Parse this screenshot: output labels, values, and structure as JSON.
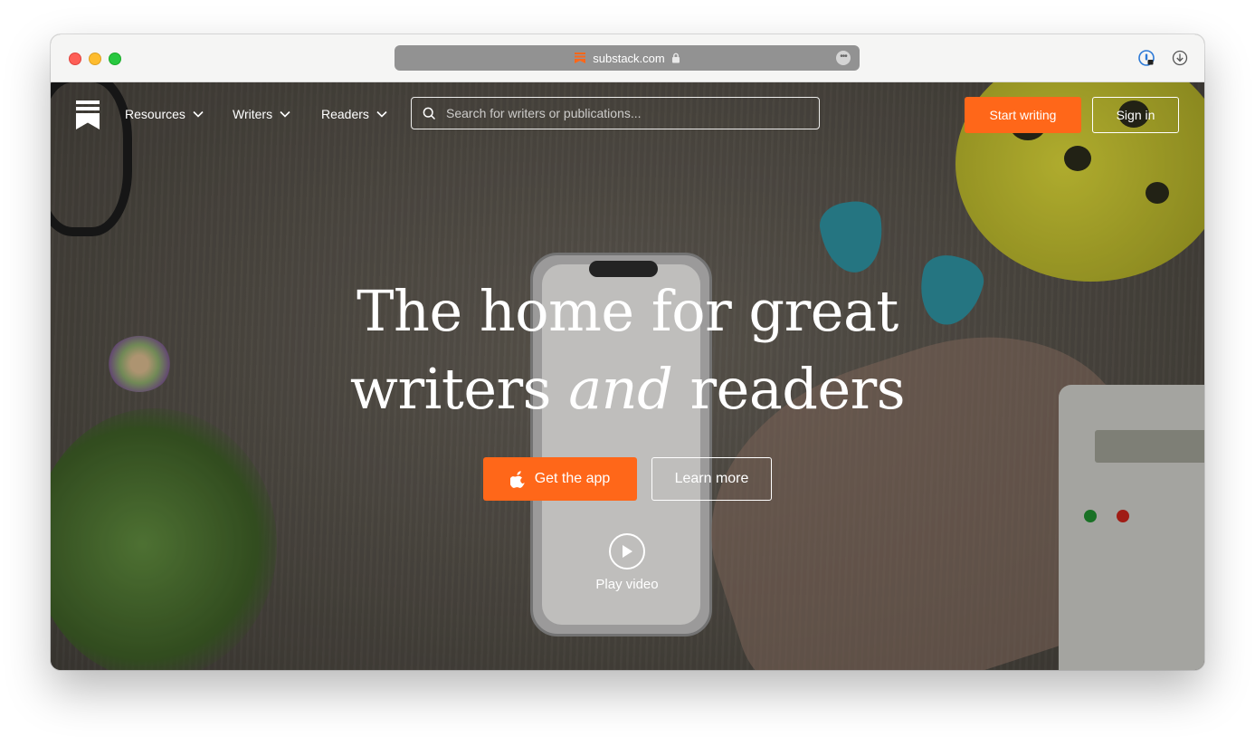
{
  "browser": {
    "url": "substack.com",
    "more_icon": "ellipsis-icon",
    "icons": [
      "password-manager-icon",
      "download-icon"
    ]
  },
  "nav": {
    "menu": [
      {
        "label": "Resources"
      },
      {
        "label": "Writers"
      },
      {
        "label": "Readers"
      }
    ],
    "search_placeholder": "Search for writers or publications...",
    "start_writing": "Start writing",
    "sign_in": "Sign in"
  },
  "hero": {
    "title_line1": "The home for great",
    "title_line2_before": "writers ",
    "title_line2_em": "and",
    "title_line2_after": " readers",
    "get_app": "Get the app",
    "learn_more": "Learn more",
    "play_video": "Play video"
  },
  "colors": {
    "accent": "#ff6719",
    "text": "#ffffff"
  }
}
